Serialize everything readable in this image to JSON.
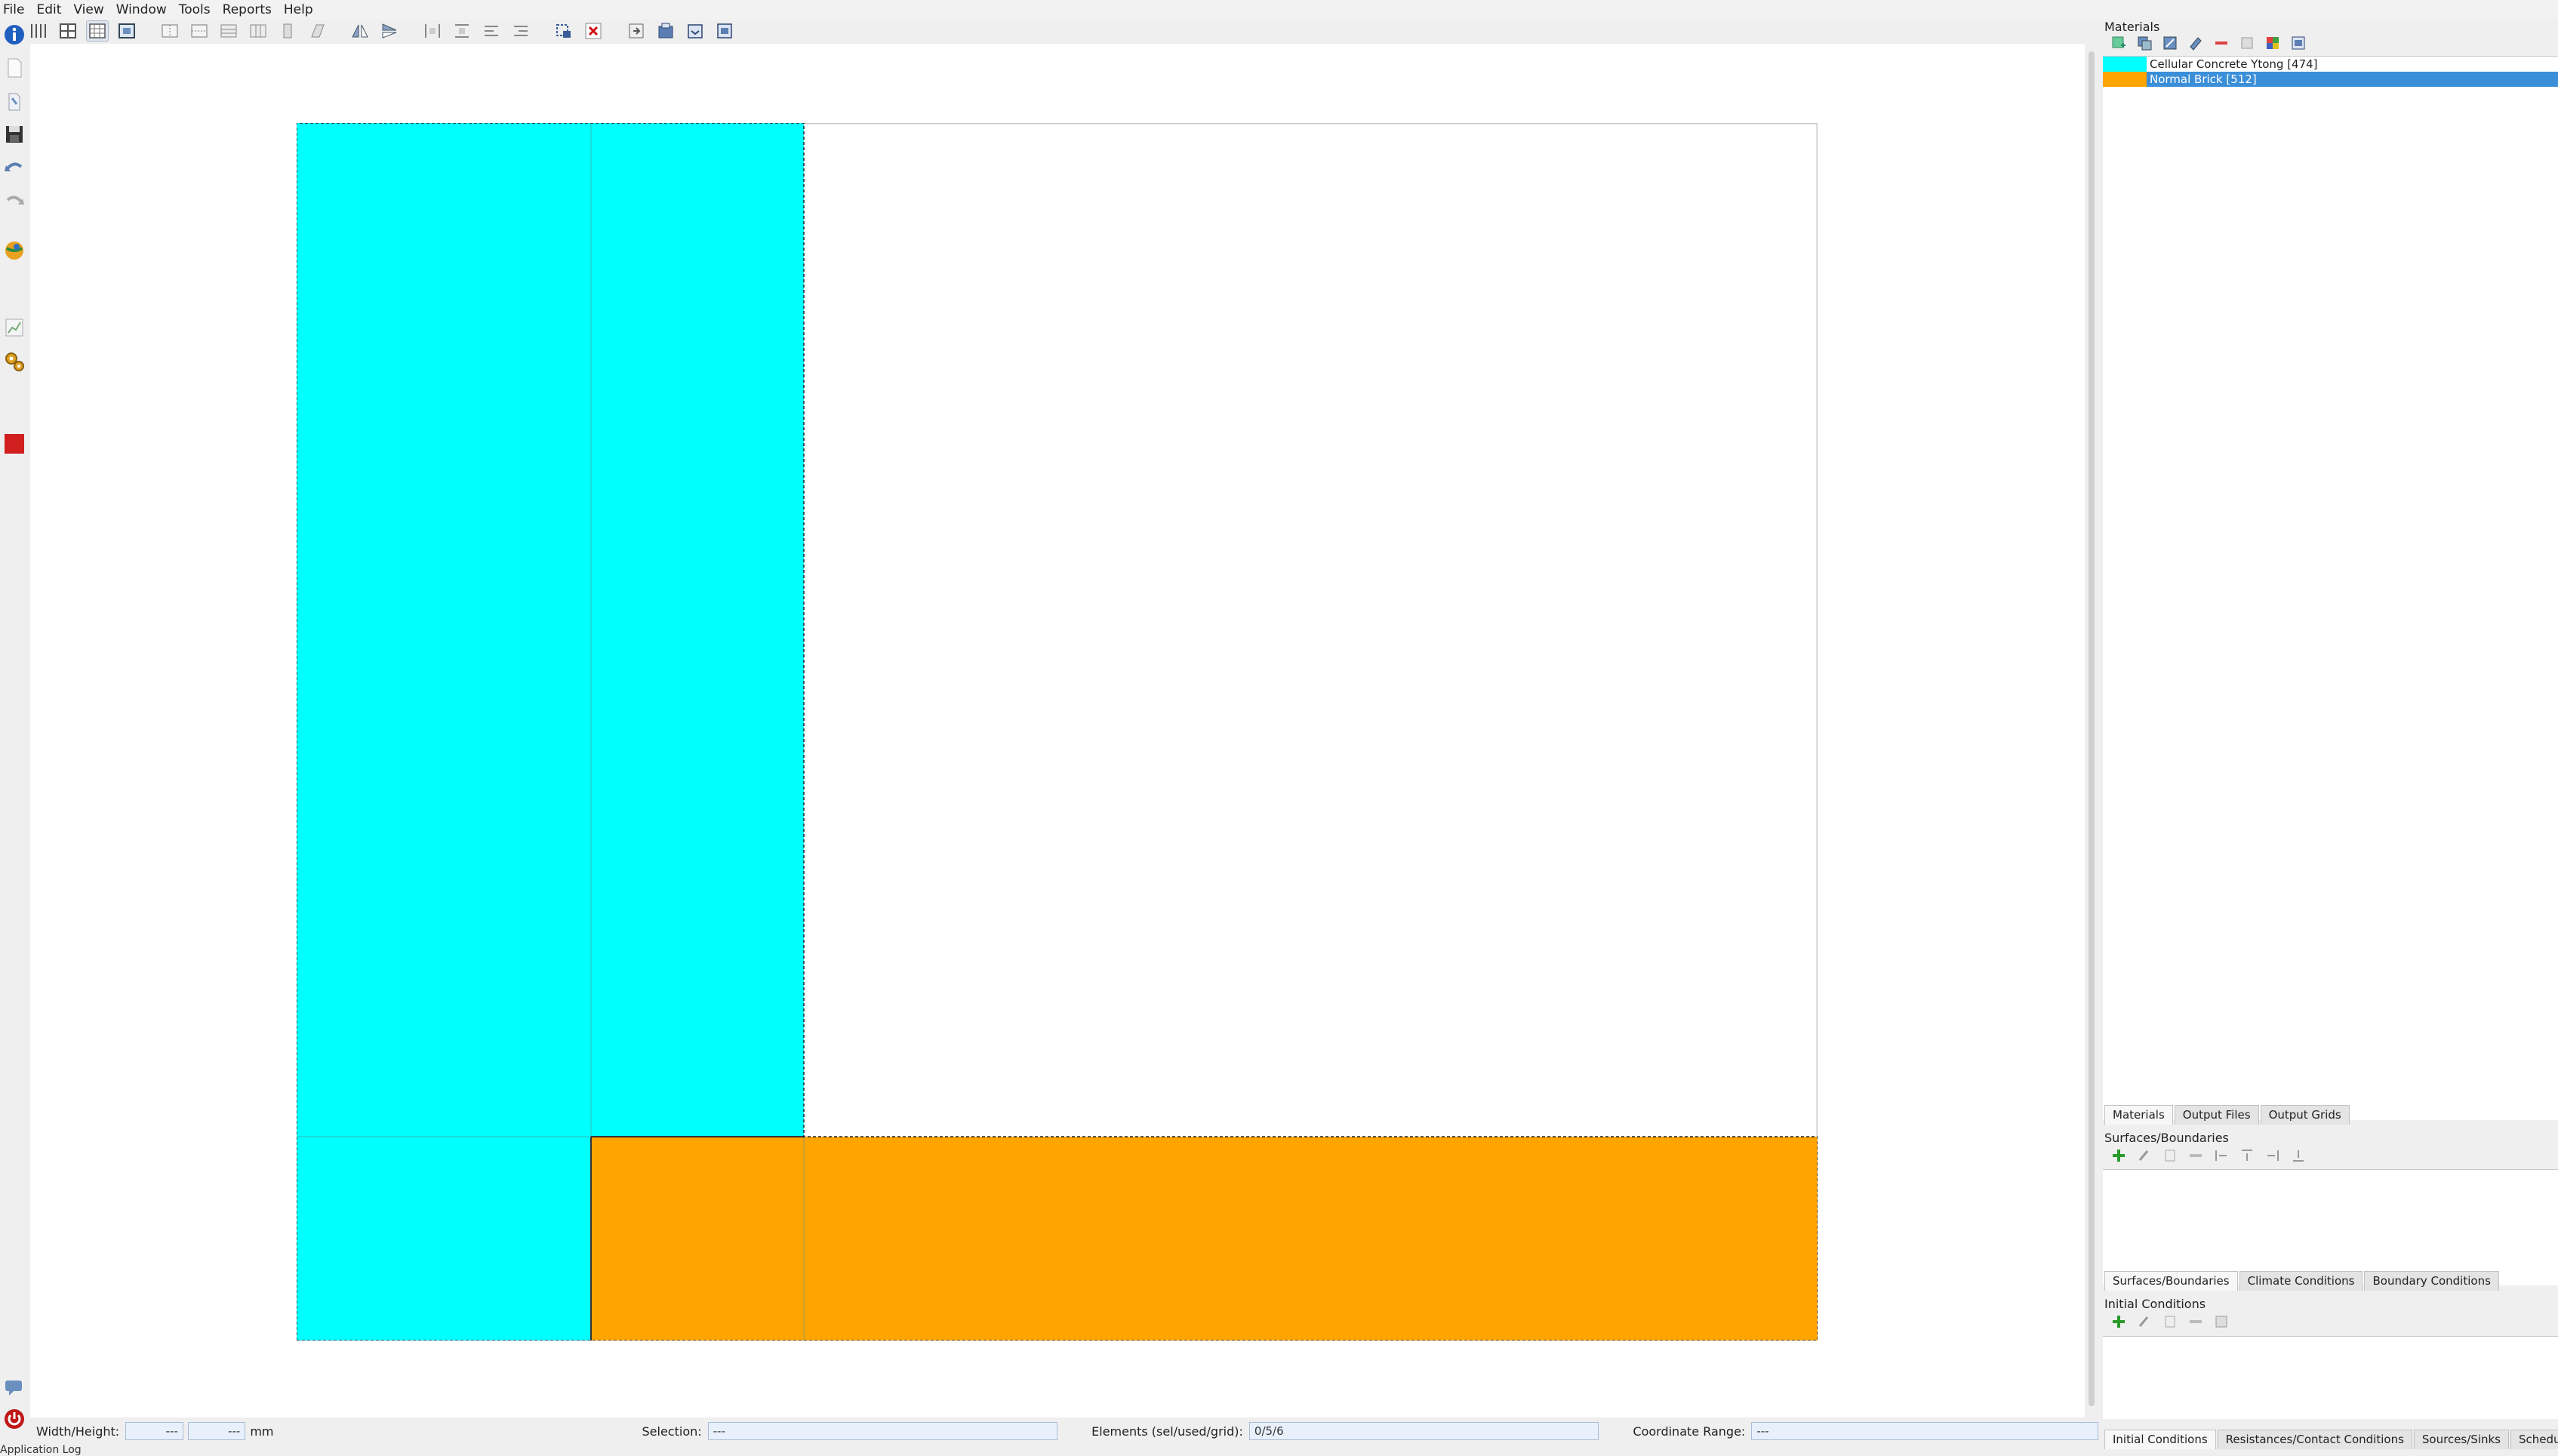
{
  "menu": [
    "File",
    "Edit",
    "View",
    "Window",
    "Tools",
    "Reports",
    "Help"
  ],
  "toolbar": {
    "buttons": [
      "grid-lines-icon",
      "table-view-icon",
      "grid-view-icon",
      "image-view-icon",
      "split-columns-icon",
      "merge-columns-icon",
      "split-rows-icon",
      "merge-rows-icon",
      "insert-column-icon",
      "skew-icon",
      "flip-horizontal-icon",
      "flip-vertical-icon",
      "distribute-horizontal-icon",
      "distribute-vertical-icon",
      "align-rows-icon",
      "align-columns-icon",
      "select-region-icon",
      "delete-icon",
      "export-icon",
      "package-icon",
      "import-icon",
      "settings-icon"
    ]
  },
  "left_toolbar": [
    "info-icon",
    "new-file-icon",
    "open-file-icon",
    "save-icon",
    "undo-icon",
    "redo-icon",
    "globe-icon",
    "chart-icon",
    "gears-icon",
    "stop-icon",
    "chat-icon",
    "power-icon"
  ],
  "construction": {
    "colors": {
      "material_a": "#00ffff",
      "material_b": "#ffa500",
      "outline": "#c9c9c9"
    }
  },
  "status": {
    "width_height_label": "Width/Height:",
    "width_value": "---",
    "height_value": "---",
    "unit": "mm",
    "selection_label": "Selection:",
    "selection_value": "---",
    "elements_label": "Elements (sel/used/grid):",
    "elements_value": "0/5/6",
    "coord_label": "Coordinate Range:",
    "coord_value": "---",
    "app_log": "Application Log"
  },
  "materials_panel": {
    "title": "Materials",
    "items": [
      {
        "name": "Cellular Concrete Ytong [474]",
        "color": "#00ffff",
        "selected": false
      },
      {
        "name": "Normal Brick [512]",
        "color": "#ffa500",
        "selected": true
      }
    ],
    "tabs": [
      "Materials",
      "Output Files",
      "Output Grids"
    ]
  },
  "surfaces_panel": {
    "title": "Surfaces/Boundaries",
    "tabs": [
      "Surfaces/Boundaries",
      "Climate Conditions",
      "Boundary Conditions"
    ]
  },
  "initial_panel": {
    "title": "Initial Conditions",
    "tabs": [
      "Initial Conditions",
      "Resistances/Contact Conditions",
      "Sources/Sinks",
      "Schedules"
    ]
  }
}
